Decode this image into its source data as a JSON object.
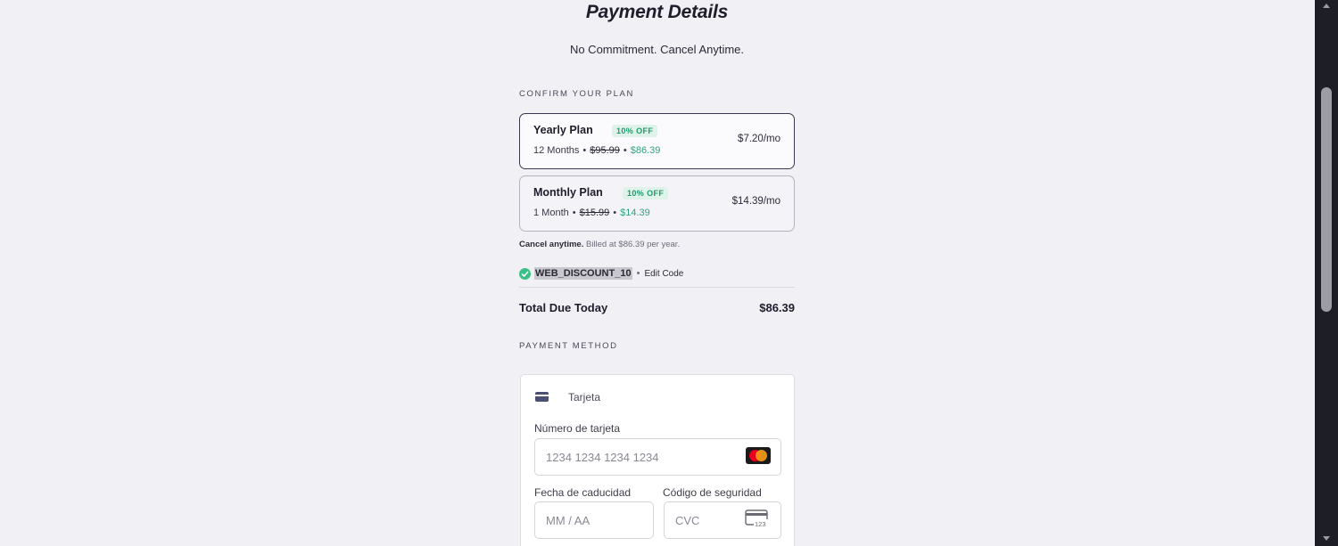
{
  "header": {
    "title": "Payment Details",
    "subtitle": "No Commitment. Cancel Anytime."
  },
  "plan_section": {
    "label": "CONFIRM YOUR PLAN",
    "plans": [
      {
        "name": "Yearly Plan",
        "badge": "10% OFF",
        "duration": "12 Months",
        "old_price": "$95.99",
        "new_price": "$86.39",
        "per_month": "$7.20/mo",
        "selected": true
      },
      {
        "name": "Monthly Plan",
        "badge": "10% OFF",
        "duration": "1 Month",
        "old_price": "$15.99",
        "new_price": "$14.39",
        "per_month": "$14.39/mo",
        "selected": false
      }
    ],
    "billing_note_bold": "Cancel anytime.",
    "billing_note_rest": "Billed at $86.39 per year."
  },
  "promo": {
    "code": "WEB_DISCOUNT_10",
    "separator": "•",
    "edit_label": "Edit Code"
  },
  "total": {
    "label": "Total Due Today",
    "value": "$86.39"
  },
  "payment_method": {
    "label": "PAYMENT METHOD",
    "tab_label": "Tarjeta",
    "card_number_label": "Número de tarjeta",
    "card_number_placeholder": "1234 1234 1234 1234",
    "expiry_label": "Fecha de caducidad",
    "expiry_placeholder": "MM / AA",
    "cvc_label": "Código de seguridad",
    "cvc_placeholder": "CVC",
    "cvc_icon_text": "123"
  },
  "colors": {
    "accent_green": "#2fa37a",
    "selected_border": "#3a3851",
    "background": "#f1f0f5"
  },
  "icons": [
    "check-circle-icon",
    "credit-card-icon",
    "mastercard-icon",
    "cvc-card-icon",
    "scroll-up-icon",
    "scroll-down-icon"
  ]
}
